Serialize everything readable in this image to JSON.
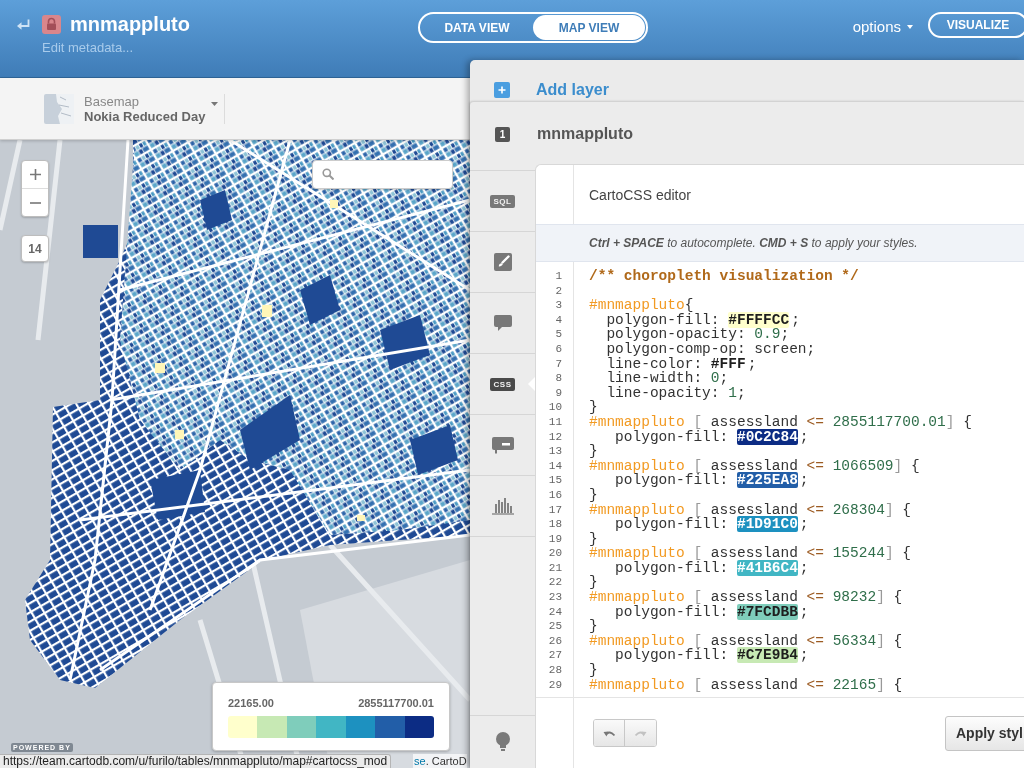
{
  "header": {
    "locked": true,
    "title": "mnmappluto",
    "subtitle": "Edit metadata...",
    "views": [
      {
        "label": "DATA VIEW",
        "selected": false
      },
      {
        "label": "MAP VIEW",
        "selected": true
      }
    ],
    "options": "options",
    "action": "VISUALIZE"
  },
  "basemap": {
    "label": "Basemap",
    "name": "Nokia Reduced Day"
  },
  "map": {
    "zoom_level": "14",
    "legend": {
      "min": "22165.00",
      "max": "2855117700.01",
      "swatches": [
        {
          "color": "#ffffcc"
        },
        {
          "color": "#c7e9b4"
        },
        {
          "color": "#7fcdbb"
        },
        {
          "color": "#41b6c4"
        },
        {
          "color": "#1d91c0"
        },
        {
          "color": "#225ea8"
        },
        {
          "color": "#0c2c84"
        }
      ]
    },
    "powered_by": "POWERED BY",
    "attribution": {
      "link": "se",
      "text": ". CartoD"
    }
  },
  "status_bar": {
    "url": "https://team.cartodb.com/u/furilo/tables/mnmappluto/map#cartocss_mod"
  },
  "layers_panel": {
    "add_layer": "Add layer",
    "layer": {
      "index": "1",
      "name": "mnmappluto"
    },
    "tabs": [
      {
        "kind": "tag",
        "label": "SQL",
        "selected": false
      },
      {
        "kind": "brush",
        "selected": false
      },
      {
        "kind": "bubble",
        "selected": false
      },
      {
        "kind": "tag",
        "label": "CSS",
        "selected": true
      },
      {
        "kind": "card",
        "selected": false
      },
      {
        "kind": "histogram",
        "selected": false
      }
    ],
    "editor": {
      "title": "CartoCSS editor",
      "hint": "**Ctrl + SPACE** to autocomplete. **CMD + S** to apply your styles.",
      "lines": [
        {
          "number": "1",
          "tokens": [
            {
              "kind": "comment",
              "text": "/** choropleth visualization */"
            }
          ]
        },
        {
          "number": "2"
        },
        {
          "number": "3",
          "tokens": [
            {
              "kind": "selector",
              "text": "#mnmappluto"
            },
            {
              "kind": "plain",
              "text": "{"
            }
          ]
        },
        {
          "number": "4",
          "tokens": [
            {
              "kind": "plain",
              "text": "  polygon-fill: "
            },
            {
              "kind": "color",
              "text": "#FFFFCC",
              "color": "#ffffcc"
            },
            {
              "kind": "plain",
              "text": ";"
            }
          ]
        },
        {
          "number": "5",
          "tokens": [
            {
              "kind": "plain",
              "text": "  polygon-opacity: "
            },
            {
              "kind": "number",
              "text": "0.9"
            },
            {
              "kind": "plain",
              "text": ";"
            }
          ]
        },
        {
          "number": "6",
          "tokens": [
            {
              "kind": "plain",
              "text": "  polygon-comp-op: screen;"
            }
          ]
        },
        {
          "number": "7",
          "tokens": [
            {
              "kind": "plain",
              "text": "  line-color: "
            },
            {
              "kind": "color",
              "text": "#FFF",
              "color": "#ffffff"
            },
            {
              "kind": "plain",
              "text": ";"
            }
          ]
        },
        {
          "number": "8",
          "tokens": [
            {
              "kind": "plain",
              "text": "  line-width: "
            },
            {
              "kind": "number",
              "text": "0"
            },
            {
              "kind": "plain",
              "text": ";"
            }
          ]
        },
        {
          "number": "9",
          "tokens": [
            {
              "kind": "plain",
              "text": "  line-opacity: "
            },
            {
              "kind": "number",
              "text": "1"
            },
            {
              "kind": "plain",
              "text": ";"
            }
          ]
        },
        {
          "number": "10",
          "tokens": [
            {
              "kind": "plain",
              "text": "}"
            }
          ]
        },
        {
          "number": "11",
          "tokens": [
            {
              "kind": "selector",
              "text": "#mnmappluto"
            },
            {
              "kind": "punct",
              "text": " ["
            },
            {
              "kind": "plain",
              "text": " assessland "
            },
            {
              "kind": "op",
              "text": "<="
            },
            {
              "kind": "number",
              "text": " 2855117700.01"
            },
            {
              "kind": "punct",
              "text": "]"
            },
            {
              "kind": "plain",
              "text": " {"
            }
          ]
        },
        {
          "number": "12",
          "tokens": [
            {
              "kind": "plain",
              "text": "   polygon-fill: "
            },
            {
              "kind": "color",
              "text": "#0C2C84",
              "color": "#0c2c84"
            },
            {
              "kind": "plain",
              "text": ";"
            }
          ]
        },
        {
          "number": "13",
          "tokens": [
            {
              "kind": "plain",
              "text": "}"
            }
          ]
        },
        {
          "number": "14",
          "tokens": [
            {
              "kind": "selector",
              "text": "#mnmappluto"
            },
            {
              "kind": "punct",
              "text": " ["
            },
            {
              "kind": "plain",
              "text": " assessland "
            },
            {
              "kind": "op",
              "text": "<="
            },
            {
              "kind": "number",
              "text": " 1066509"
            },
            {
              "kind": "punct",
              "text": "]"
            },
            {
              "kind": "plain",
              "text": " {"
            }
          ]
        },
        {
          "number": "15",
          "tokens": [
            {
              "kind": "plain",
              "text": "   polygon-fill: "
            },
            {
              "kind": "color",
              "text": "#225EA8",
              "color": "#225ea8"
            },
            {
              "kind": "plain",
              "text": ";"
            }
          ]
        },
        {
          "number": "16",
          "tokens": [
            {
              "kind": "plain",
              "text": "}"
            }
          ]
        },
        {
          "number": "17",
          "tokens": [
            {
              "kind": "selector",
              "text": "#mnmappluto"
            },
            {
              "kind": "punct",
              "text": " ["
            },
            {
              "kind": "plain",
              "text": " assessland "
            },
            {
              "kind": "op",
              "text": "<="
            },
            {
              "kind": "number",
              "text": " 268304"
            },
            {
              "kind": "punct",
              "text": "]"
            },
            {
              "kind": "plain",
              "text": " {"
            }
          ]
        },
        {
          "number": "18",
          "tokens": [
            {
              "kind": "plain",
              "text": "   polygon-fill: "
            },
            {
              "kind": "color",
              "text": "#1D91C0",
              "color": "#1d91c0"
            },
            {
              "kind": "plain",
              "text": ";"
            }
          ]
        },
        {
          "number": "19",
          "tokens": [
            {
              "kind": "plain",
              "text": "}"
            }
          ]
        },
        {
          "number": "20",
          "tokens": [
            {
              "kind": "selector",
              "text": "#mnmappluto"
            },
            {
              "kind": "punct",
              "text": " ["
            },
            {
              "kind": "plain",
              "text": " assessland "
            },
            {
              "kind": "op",
              "text": "<="
            },
            {
              "kind": "number",
              "text": " 155244"
            },
            {
              "kind": "punct",
              "text": "]"
            },
            {
              "kind": "plain",
              "text": " {"
            }
          ]
        },
        {
          "number": "21",
          "tokens": [
            {
              "kind": "plain",
              "text": "   polygon-fill: "
            },
            {
              "kind": "color",
              "text": "#41B6C4",
              "color": "#41b6c4"
            },
            {
              "kind": "plain",
              "text": ";"
            }
          ]
        },
        {
          "number": "22",
          "tokens": [
            {
              "kind": "plain",
              "text": "}"
            }
          ]
        },
        {
          "number": "23",
          "tokens": [
            {
              "kind": "selector",
              "text": "#mnmappluto"
            },
            {
              "kind": "punct",
              "text": " ["
            },
            {
              "kind": "plain",
              "text": " assessland "
            },
            {
              "kind": "op",
              "text": "<="
            },
            {
              "kind": "number",
              "text": " 98232"
            },
            {
              "kind": "punct",
              "text": "]"
            },
            {
              "kind": "plain",
              "text": " {"
            }
          ]
        },
        {
          "number": "24",
          "tokens": [
            {
              "kind": "plain",
              "text": "   polygon-fill: "
            },
            {
              "kind": "color",
              "text": "#7FCDBB",
              "color": "#7fcdbb"
            },
            {
              "kind": "plain",
              "text": ";"
            }
          ]
        },
        {
          "number": "25",
          "tokens": [
            {
              "kind": "plain",
              "text": "}"
            }
          ]
        },
        {
          "number": "26",
          "tokens": [
            {
              "kind": "selector",
              "text": "#mnmappluto"
            },
            {
              "kind": "punct",
              "text": " ["
            },
            {
              "kind": "plain",
              "text": " assessland "
            },
            {
              "kind": "op",
              "text": "<="
            },
            {
              "kind": "number",
              "text": " 56334"
            },
            {
              "kind": "punct",
              "text": "]"
            },
            {
              "kind": "plain",
              "text": " {"
            }
          ]
        },
        {
          "number": "27",
          "tokens": [
            {
              "kind": "plain",
              "text": "   polygon-fill: "
            },
            {
              "kind": "color",
              "text": "#C7E9B4",
              "color": "#c7e9b4"
            },
            {
              "kind": "plain",
              "text": ";"
            }
          ]
        },
        {
          "number": "28",
          "tokens": [
            {
              "kind": "plain",
              "text": "}"
            }
          ]
        },
        {
          "number": "29",
          "tokens": [
            {
              "kind": "selector",
              "text": "#mnmappluto"
            },
            {
              "kind": "punct",
              "text": " ["
            },
            {
              "kind": "plain",
              "text": " assessland "
            },
            {
              "kind": "op",
              "text": "<="
            },
            {
              "kind": "number",
              "text": " 22165"
            },
            {
              "kind": "punct",
              "text": "]"
            },
            {
              "kind": "plain",
              "text": " {"
            }
          ]
        }
      ],
      "history": [
        {
          "kind": "undo",
          "disabled": false
        },
        {
          "kind": "redo",
          "disabled": true
        }
      ],
      "apply": "Apply styl"
    }
  }
}
